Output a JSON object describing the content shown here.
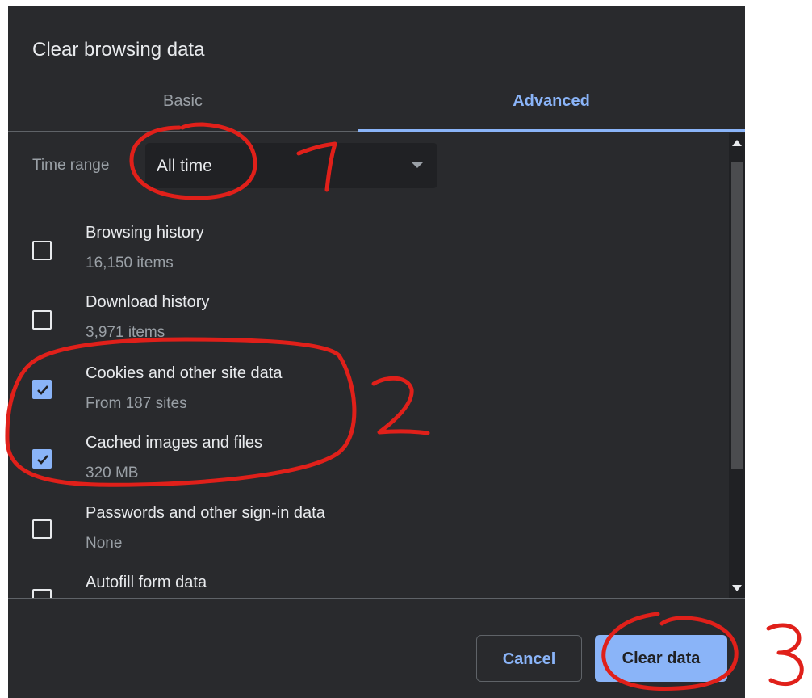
{
  "dialog": {
    "title": "Clear browsing data",
    "tabs": [
      {
        "label": "Basic",
        "active": false
      },
      {
        "label": "Advanced",
        "active": true
      }
    ],
    "time_range": {
      "label": "Time range",
      "value": "All time"
    },
    "items": [
      {
        "label": "Browsing history",
        "sub": "16,150 items",
        "checked": false
      },
      {
        "label": "Download history",
        "sub": "3,971 items",
        "checked": false
      },
      {
        "label": "Cookies and other site data",
        "sub": "From 187 sites",
        "checked": true
      },
      {
        "label": "Cached images and files",
        "sub": "320 MB",
        "checked": true
      },
      {
        "label": "Passwords and other sign-in data",
        "sub": "None",
        "checked": false
      },
      {
        "label": "Autofill form data",
        "sub": "",
        "checked": false
      }
    ],
    "buttons": {
      "cancel": "Cancel",
      "clear": "Clear data"
    }
  },
  "colors": {
    "background": "#292a2d",
    "accent": "#8ab4f8",
    "text_primary": "#e8eaed",
    "text_secondary": "#9aa0a6",
    "annotation": "#e0201a"
  }
}
